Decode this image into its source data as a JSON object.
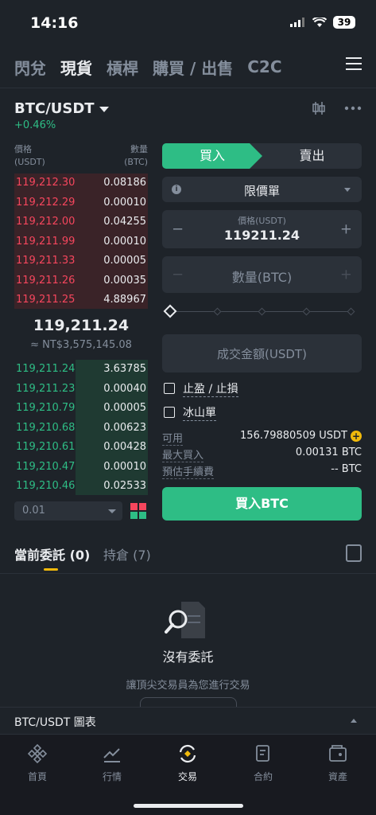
{
  "status_bar": {
    "time": "14:16",
    "battery": "39"
  },
  "top_tabs": [
    {
      "label": "閃兌"
    },
    {
      "label": "現貨"
    },
    {
      "label": "槓桿"
    },
    {
      "label": "購買 / 出售"
    },
    {
      "label": "C2C"
    }
  ],
  "pair": {
    "name": "BTC/USDT",
    "change": "+0.46%"
  },
  "orderbook": {
    "price_header": "價格",
    "price_unit": "(USDT)",
    "qty_header": "數量",
    "qty_unit": "(BTC)",
    "asks": [
      {
        "price": "119,212.30",
        "qty": "0.08186"
      },
      {
        "price": "119,212.29",
        "qty": "0.00010"
      },
      {
        "price": "119,212.00",
        "qty": "0.04255"
      },
      {
        "price": "119,211.99",
        "qty": "0.00010"
      },
      {
        "price": "119,211.33",
        "qty": "0.00005"
      },
      {
        "price": "119,211.26",
        "qty": "0.00035"
      },
      {
        "price": "119,211.25",
        "qty": "4.88967"
      }
    ],
    "last_price": "119,211.24",
    "fiat_price": "≈ NT$3,575,145.08",
    "bids": [
      {
        "price": "119,211.24",
        "qty": "3.63785"
      },
      {
        "price": "119,211.23",
        "qty": "0.00040"
      },
      {
        "price": "119,210.79",
        "qty": "0.00005"
      },
      {
        "price": "119,210.68",
        "qty": "0.00623"
      },
      {
        "price": "119,210.61",
        "qty": "0.00428"
      },
      {
        "price": "119,210.47",
        "qty": "0.00010"
      },
      {
        "price": "119,210.46",
        "qty": "0.02533"
      }
    ],
    "precision": "0.01"
  },
  "trade_form": {
    "buy_label": "買入",
    "sell_label": "賣出",
    "order_type": "限價單",
    "price_label": "價格(USDT)",
    "price_value": "119211.24",
    "qty_placeholder": "數量(BTC)",
    "total_placeholder": "成交金額(USDT)",
    "tp_sl_label": "止盈 / 止損",
    "iceberg_label": "冰山單",
    "available_label": "可用",
    "available_value": "156.79880509 USDT",
    "max_buy_label": "最大買入",
    "max_buy_value": "0.00131 BTC",
    "fee_label": "預估手續費",
    "fee_value": "-- BTC",
    "submit_label": "買入BTC"
  },
  "orders": {
    "tab_open": "當前委託 (0)",
    "tab_holdings": "持倉 (7)",
    "empty_title": "沒有委託",
    "empty_sub": "讓頂尖交易員為您進行交易"
  },
  "chart_bar": {
    "label": "BTC/USDT 圖表"
  },
  "bottom_nav": [
    {
      "label": "首頁",
      "icon": "home-icon"
    },
    {
      "label": "行情",
      "icon": "markets-icon"
    },
    {
      "label": "交易",
      "icon": "trade-icon"
    },
    {
      "label": "合約",
      "icon": "futures-icon"
    },
    {
      "label": "資產",
      "icon": "wallet-icon"
    }
  ],
  "colors": {
    "buy": "#2ebd85",
    "sell": "#f6465d",
    "accent": "#f0b90b",
    "bg": "#1e2329"
  }
}
